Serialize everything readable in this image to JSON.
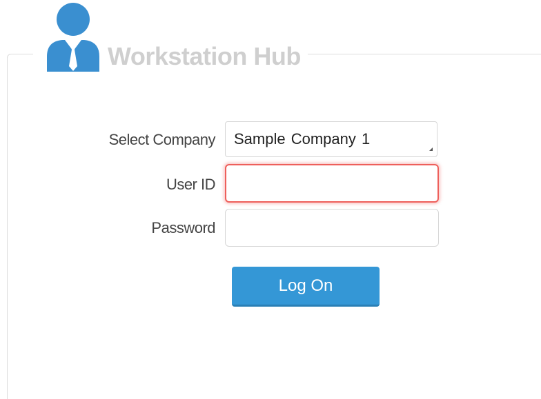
{
  "header": {
    "title": "Workstation Hub",
    "icon": "user-icon"
  },
  "form": {
    "company_label": "Select Company",
    "company_value": "Sample Company  1",
    "user_id_label": "User ID",
    "user_id_value": "",
    "password_label": "Password",
    "password_value": "",
    "logon_label": "Log On"
  },
  "colors": {
    "accent": "#3497d6",
    "error_border": "#ee5f5b",
    "title_gray": "#cfcfcf"
  }
}
